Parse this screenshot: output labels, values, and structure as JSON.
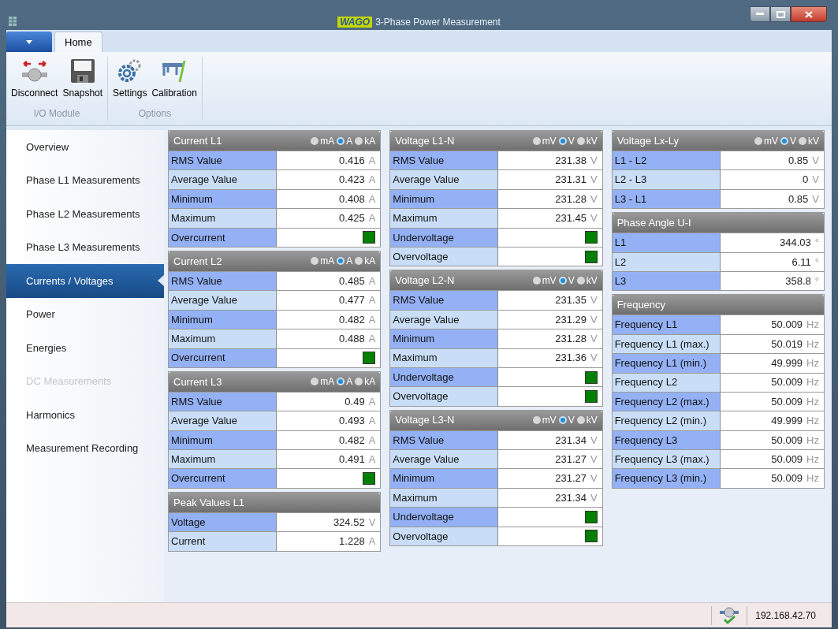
{
  "window": {
    "logo": "WAGO",
    "title": "3-Phase Power Measurement"
  },
  "ribbon": {
    "tabs": [
      {
        "label": "Home",
        "selected": true
      }
    ],
    "groups": [
      {
        "label": "I/O Module",
        "buttons": [
          {
            "label": "Disconnect",
            "kind": "disconnect"
          },
          {
            "label": "Snapshot",
            "kind": "snapshot"
          }
        ]
      },
      {
        "label": "Options",
        "buttons": [
          {
            "label": "Settings",
            "kind": "settings"
          },
          {
            "label": "Calibration",
            "kind": "calibration"
          }
        ]
      }
    ]
  },
  "sidebar": {
    "items": [
      {
        "label": "Overview",
        "selected": false,
        "disabled": false
      },
      {
        "label": "Phase L1 Measurements",
        "selected": false,
        "disabled": false
      },
      {
        "label": "Phase L2 Measurements",
        "selected": false,
        "disabled": false
      },
      {
        "label": "Phase L3 Measurements",
        "selected": false,
        "disabled": false
      },
      {
        "label": "Currents / Voltages",
        "selected": true,
        "disabled": false
      },
      {
        "label": "Power",
        "selected": false,
        "disabled": false
      },
      {
        "label": "Energies",
        "selected": false,
        "disabled": false
      },
      {
        "label": "DC Measurements",
        "selected": false,
        "disabled": true
      },
      {
        "label": "Harmonics",
        "selected": false,
        "disabled": false
      },
      {
        "label": "Measurement Recording",
        "selected": false,
        "disabled": false
      }
    ]
  },
  "columns": [
    [
      {
        "title": "Current L1",
        "units": [
          {
            "label": "mA",
            "selected": false
          },
          {
            "label": "A",
            "selected": true
          },
          {
            "label": "kA",
            "selected": false
          }
        ],
        "rows": [
          {
            "kind": "value",
            "label": "RMS Value",
            "value": "0.416",
            "unit": "A"
          },
          {
            "kind": "value",
            "label": "Average Value",
            "value": "0.423",
            "unit": "A"
          },
          {
            "kind": "value",
            "label": "Minimum",
            "value": "0.408",
            "unit": "A"
          },
          {
            "kind": "value",
            "label": "Maximum",
            "value": "0.425",
            "unit": "A"
          },
          {
            "kind": "indicator",
            "label": "Overcurrent",
            "color": "#008000"
          }
        ]
      },
      {
        "title": "Current L2",
        "units": [
          {
            "label": "mA",
            "selected": false
          },
          {
            "label": "A",
            "selected": true
          },
          {
            "label": "kA",
            "selected": false
          }
        ],
        "rows": [
          {
            "kind": "value",
            "label": "RMS Value",
            "value": "0.485",
            "unit": "A"
          },
          {
            "kind": "value",
            "label": "Average Value",
            "value": "0.477",
            "unit": "A"
          },
          {
            "kind": "value",
            "label": "Minimum",
            "value": "0.482",
            "unit": "A"
          },
          {
            "kind": "value",
            "label": "Maximum",
            "value": "0.488",
            "unit": "A"
          },
          {
            "kind": "indicator",
            "label": "Overcurrent",
            "color": "#008000"
          }
        ]
      },
      {
        "title": "Current L3",
        "units": [
          {
            "label": "mA",
            "selected": false
          },
          {
            "label": "A",
            "selected": true
          },
          {
            "label": "kA",
            "selected": false
          }
        ],
        "rows": [
          {
            "kind": "value",
            "label": "RMS Value",
            "value": "0.49",
            "unit": "A"
          },
          {
            "kind": "value",
            "label": "Average Value",
            "value": "0.493",
            "unit": "A"
          },
          {
            "kind": "value",
            "label": "Minimum",
            "value": "0.482",
            "unit": "A"
          },
          {
            "kind": "value",
            "label": "Maximum",
            "value": "0.491",
            "unit": "A"
          },
          {
            "kind": "indicator",
            "label": "Overcurrent",
            "color": "#008000"
          }
        ]
      },
      {
        "title": "Peak Values L1",
        "rows": [
          {
            "kind": "value",
            "label": "Voltage",
            "value": "324.52",
            "unit": "V"
          },
          {
            "kind": "value",
            "label": "Current",
            "value": "1.228",
            "unit": "A"
          }
        ]
      }
    ],
    [
      {
        "title": "Voltage L1-N",
        "units": [
          {
            "label": "mV",
            "selected": false
          },
          {
            "label": "V",
            "selected": true
          },
          {
            "label": "kV",
            "selected": false
          }
        ],
        "rows": [
          {
            "kind": "value",
            "label": "RMS Value",
            "value": "231.38",
            "unit": "V"
          },
          {
            "kind": "value",
            "label": "Average Value",
            "value": "231.31",
            "unit": "V"
          },
          {
            "kind": "value",
            "label": "Minimum",
            "value": "231.28",
            "unit": "V"
          },
          {
            "kind": "value",
            "label": "Maximum",
            "value": "231.45",
            "unit": "V"
          },
          {
            "kind": "indicator",
            "label": "Undervoltage",
            "color": "#008000"
          },
          {
            "kind": "indicator",
            "label": "Overvoltage",
            "color": "#008000"
          }
        ]
      },
      {
        "title": "Voltage L2-N",
        "units": [
          {
            "label": "mV",
            "selected": false
          },
          {
            "label": "V",
            "selected": true
          },
          {
            "label": "kV",
            "selected": false
          }
        ],
        "rows": [
          {
            "kind": "value",
            "label": "RMS Value",
            "value": "231.35",
            "unit": "V"
          },
          {
            "kind": "value",
            "label": "Average Value",
            "value": "231.29",
            "unit": "V"
          },
          {
            "kind": "value",
            "label": "Minimum",
            "value": "231.28",
            "unit": "V"
          },
          {
            "kind": "value",
            "label": "Maximum",
            "value": "231.36",
            "unit": "V"
          },
          {
            "kind": "indicator",
            "label": "Undervoltage",
            "color": "#008000"
          },
          {
            "kind": "indicator",
            "label": "Overvoltage",
            "color": "#008000"
          }
        ]
      },
      {
        "title": "Voltage L3-N",
        "units": [
          {
            "label": "mV",
            "selected": false
          },
          {
            "label": "V",
            "selected": true
          },
          {
            "label": "kV",
            "selected": false
          }
        ],
        "rows": [
          {
            "kind": "value",
            "label": "RMS Value",
            "value": "231.34",
            "unit": "V"
          },
          {
            "kind": "value",
            "label": "Average Value",
            "value": "231.27",
            "unit": "V"
          },
          {
            "kind": "value",
            "label": "Minimum",
            "value": "231.27",
            "unit": "V"
          },
          {
            "kind": "value",
            "label": "Maximum",
            "value": "231.34",
            "unit": "V"
          },
          {
            "kind": "indicator",
            "label": "Undervoltage",
            "color": "#008000"
          },
          {
            "kind": "indicator",
            "label": "Overvoltage",
            "color": "#008000"
          }
        ]
      }
    ],
    [
      {
        "title": "Voltage Lx-Ly",
        "units": [
          {
            "label": "mV",
            "selected": false
          },
          {
            "label": "V",
            "selected": true
          },
          {
            "label": "kV",
            "selected": false
          }
        ],
        "rows": [
          {
            "kind": "value",
            "label": "L1 - L2",
            "value": "0.85",
            "unit": "V"
          },
          {
            "kind": "value",
            "label": "L2 - L3",
            "value": "0",
            "unit": "V"
          },
          {
            "kind": "value",
            "label": "L3 - L1",
            "value": "0.85",
            "unit": "V"
          }
        ]
      },
      {
        "title": "Phase Angle U-I",
        "rows": [
          {
            "kind": "value",
            "label": "L1",
            "value": "344.03",
            "unit": "°"
          },
          {
            "kind": "value",
            "label": "L2",
            "value": "6.11",
            "unit": "°"
          },
          {
            "kind": "value",
            "label": "L3",
            "value": "358.8",
            "unit": "°"
          }
        ]
      },
      {
        "title": "Frequency",
        "rows": [
          {
            "kind": "value",
            "label": "Frequency L1",
            "value": "50.009",
            "unit": "Hz"
          },
          {
            "kind": "value",
            "label": "Frequency L1 (max.)",
            "value": "50.019",
            "unit": "Hz"
          },
          {
            "kind": "value",
            "label": "Frequency L1 (min.)",
            "value": "49.999",
            "unit": "Hz"
          },
          {
            "kind": "value",
            "label": "Frequency L2",
            "value": "50.009",
            "unit": "Hz"
          },
          {
            "kind": "value",
            "label": "Frequency L2 (max.)",
            "value": "50.009",
            "unit": "Hz"
          },
          {
            "kind": "value",
            "label": "Frequency L2 (min.)",
            "value": "49.999",
            "unit": "Hz"
          },
          {
            "kind": "value",
            "label": "Frequency L3",
            "value": "50.009",
            "unit": "Hz"
          },
          {
            "kind": "value",
            "label": "Frequency L3 (max.)",
            "value": "50.009",
            "unit": "Hz"
          },
          {
            "kind": "value",
            "label": "Frequency L3 (min.)",
            "value": "50.009",
            "unit": "Hz"
          }
        ]
      }
    ]
  ],
  "status_bar": {
    "address": "192.168.42.70"
  }
}
